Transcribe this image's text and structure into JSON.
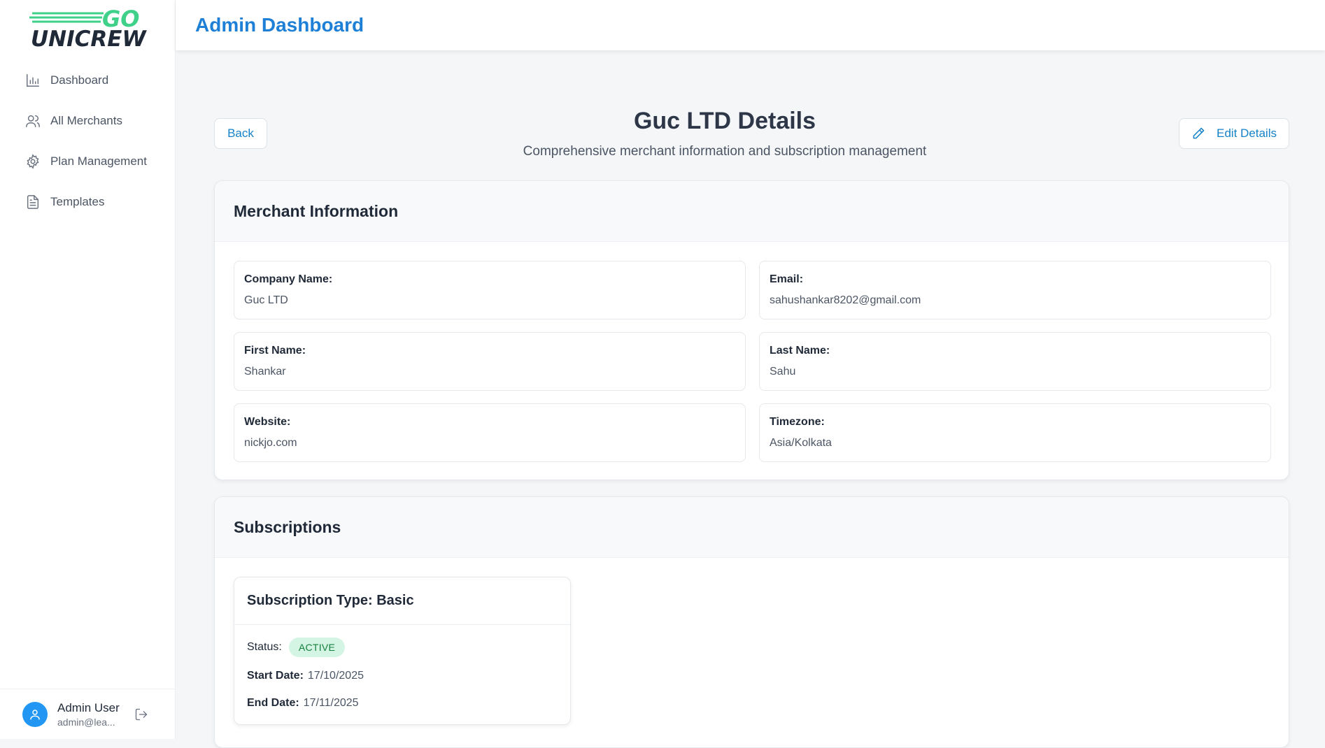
{
  "app": {
    "logo_top": "GO",
    "logo_bottom": "UNICREW",
    "header_title": "Admin Dashboard"
  },
  "sidebar": {
    "items": [
      {
        "label": "Dashboard",
        "icon": "bar-chart-icon"
      },
      {
        "label": "All Merchants",
        "icon": "users-icon"
      },
      {
        "label": "Plan Management",
        "icon": "gear-icon"
      },
      {
        "label": "Templates",
        "icon": "document-icon"
      }
    ],
    "user": {
      "name": "Admin User",
      "email": "admin@lea..."
    }
  },
  "page": {
    "title": "Guc LTD Details",
    "subtitle": "Comprehensive merchant information and subscription management",
    "back_label": "Back",
    "edit_label": "Edit Details"
  },
  "merchant": {
    "section_title": "Merchant Information",
    "fields": [
      {
        "label": "Company Name:",
        "value": "Guc LTD"
      },
      {
        "label": "Email:",
        "value": "sahushankar8202@gmail.com"
      },
      {
        "label": "First Name:",
        "value": "Shankar"
      },
      {
        "label": "Last Name:",
        "value": "Sahu"
      },
      {
        "label": "Website:",
        "value": "nickjo.com"
      },
      {
        "label": "Timezone:",
        "value": "Asia/Kolkata"
      }
    ]
  },
  "subscriptions": {
    "section_title": "Subscriptions",
    "items": [
      {
        "type_label": "Subscription Type: Basic",
        "status_label": "Status:",
        "status": "ACTIVE",
        "start_label": "Start Date:",
        "start_date": "17/10/2025",
        "end_label": "End Date:",
        "end_date": "17/11/2025"
      }
    ]
  },
  "colors": {
    "accent": "#1682c8",
    "header_title": "#1e7fd6",
    "logo_green": "#3fd08a",
    "avatar": "#2196f3",
    "status_active_bg": "#d4f5e4",
    "status_active_text": "#15803d"
  }
}
